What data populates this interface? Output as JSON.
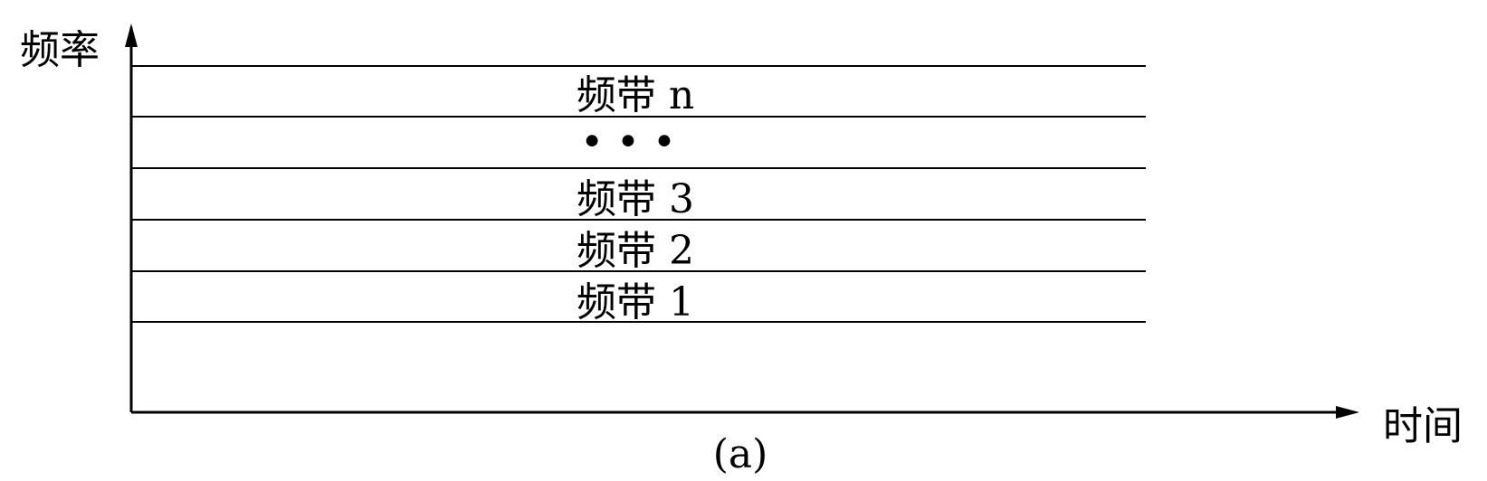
{
  "axes": {
    "y_label": "频率",
    "x_label": "时间"
  },
  "bands": [
    {
      "label": "频带 n"
    },
    {
      "label": "• • •"
    },
    {
      "label": "频带 3"
    },
    {
      "label": "频带 2"
    },
    {
      "label": "频带 1"
    }
  ],
  "caption": "(a)"
}
